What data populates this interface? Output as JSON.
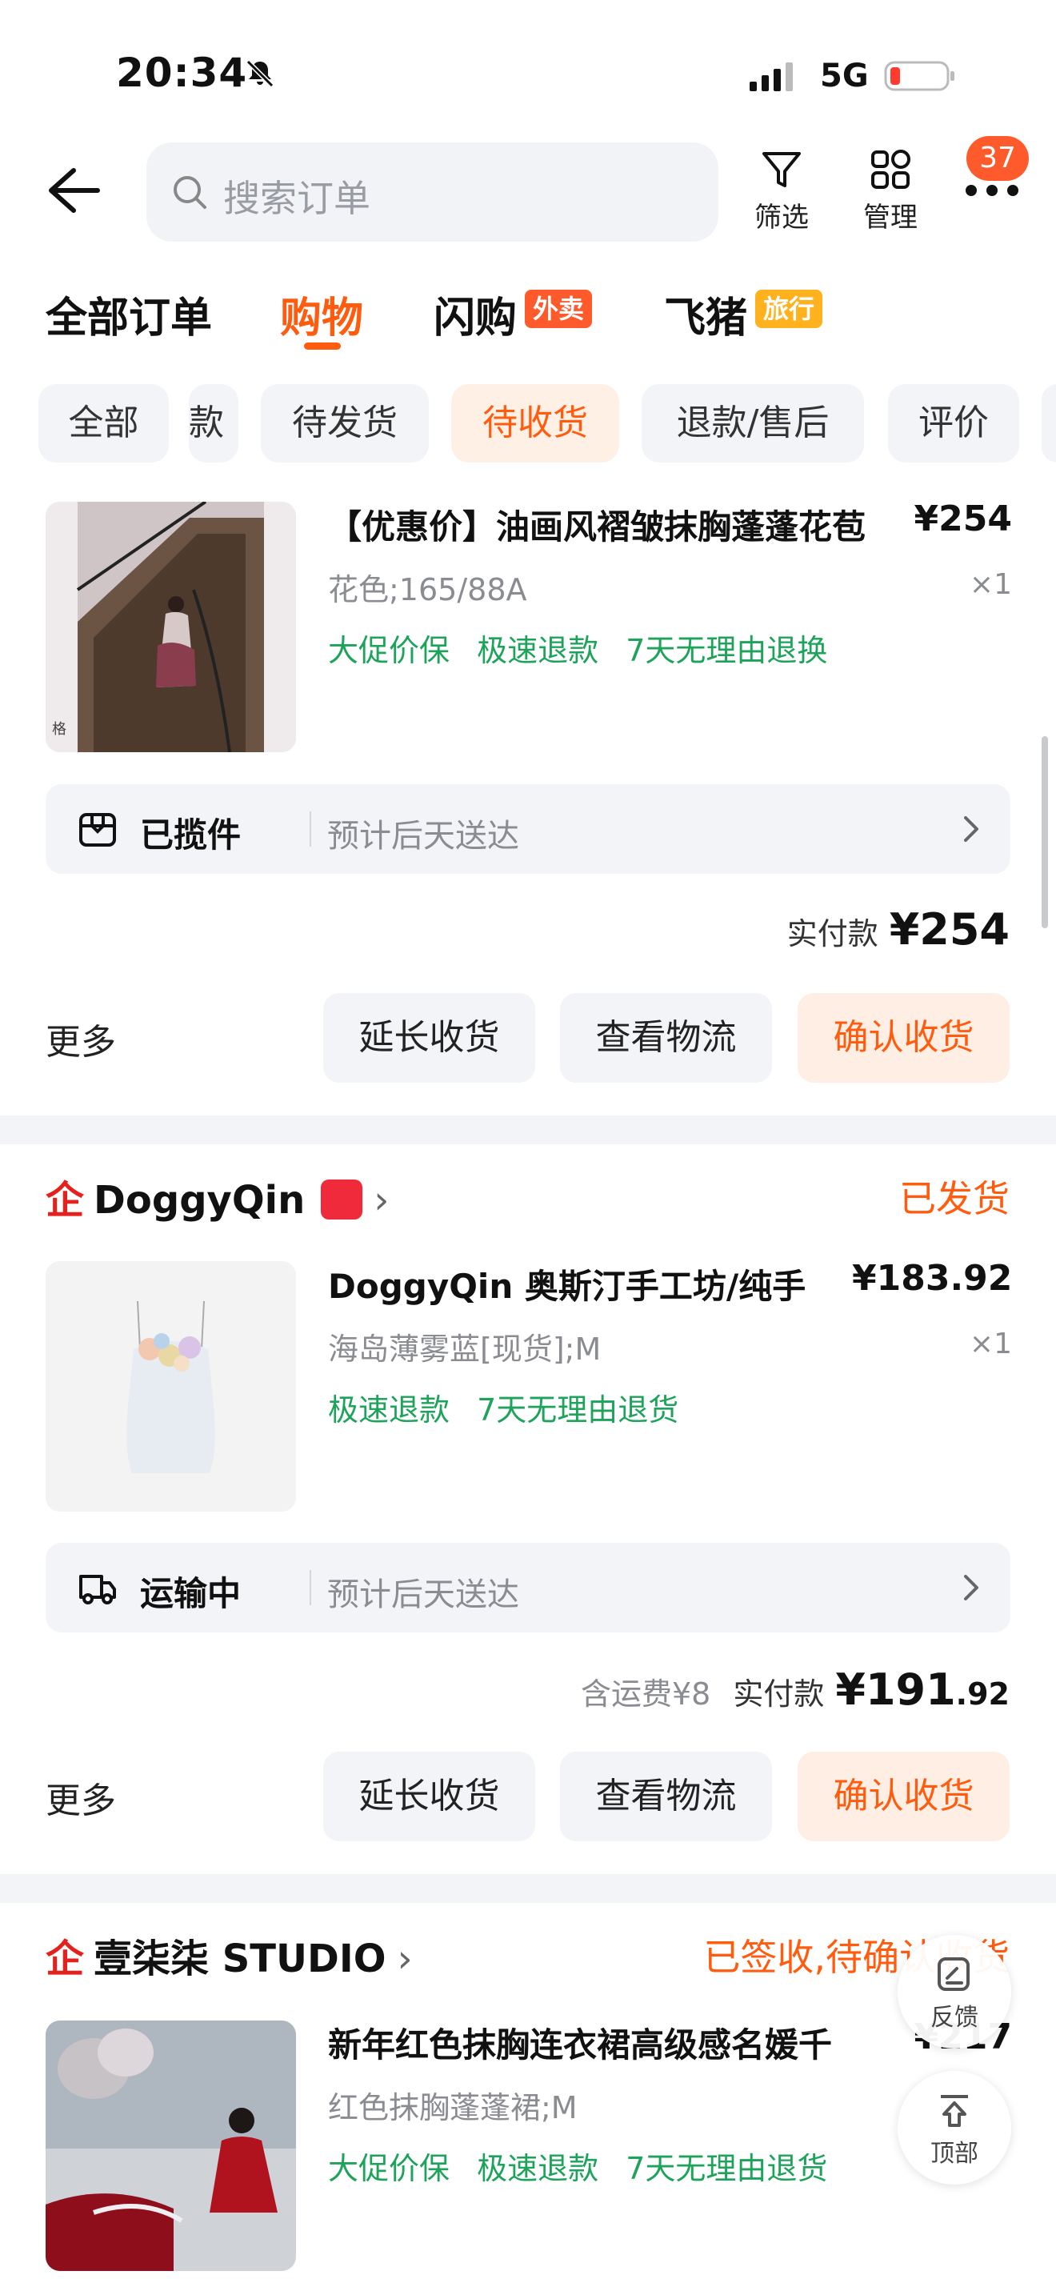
{
  "status_bar": {
    "time": "20:34",
    "network": "5G"
  },
  "header": {
    "search_placeholder": "搜索订单",
    "filter_label": "筛选",
    "manage_label": "管理",
    "message_count": "37"
  },
  "categories": [
    {
      "label": "全部订单"
    },
    {
      "label": "购物"
    },
    {
      "label": "闪购",
      "tag": "外卖"
    },
    {
      "label": "飞猪",
      "tag": "旅行"
    }
  ],
  "status_chips": [
    "全部",
    "款",
    "待发货",
    "待收货",
    "退款/售后",
    "评价"
  ],
  "orders": [
    {
      "title": "【优惠价】油画风褶皱抹胸蓬蓬花苞",
      "price": "¥254",
      "spec": "花色;165/88A",
      "qty": "×1",
      "tags": [
        "大促价保",
        "极速退款",
        "7天无理由退换"
      ],
      "logistics_status": "已揽件",
      "logistics_eta": "预计后天送达",
      "paid_label": "实付款",
      "paid_amount": "¥254",
      "more": "更多",
      "actions": [
        "延长收货",
        "查看物流",
        "确认收货"
      ]
    },
    {
      "shop_name": "DoggyQin",
      "order_status": "已发货",
      "title": "DoggyQin 奥斯汀手工坊/纯手",
      "price": "¥183.92",
      "spec": "海岛薄雾蓝[现货];M",
      "qty": "×1",
      "tags": [
        "极速退款",
        "7天无理由退货"
      ],
      "logistics_status": "运输中",
      "logistics_eta": "预计后天送达",
      "shipping_fee": "含运费¥8",
      "paid_label": "实付款",
      "paid_amount": "¥191",
      "paid_cents": ".92",
      "more": "更多",
      "actions": [
        "延长收货",
        "查看物流",
        "确认收货"
      ]
    },
    {
      "shop_name": "壹柒柒 STUDIO",
      "order_status": "已签收,待确认收货",
      "title": "新年红色抹胸连衣裙高级感名媛千",
      "price": "¥217",
      "spec": "红色抹胸蓬蓬裙;M",
      "tags": [
        "大促价保",
        "极速退款",
        "7天无理由退货"
      ]
    }
  ],
  "floating": {
    "feedback": "反馈",
    "top": "顶部"
  },
  "colors": {
    "accent": "#ff5c0f",
    "green": "#1ea35a",
    "tag_red": "#ff5a2c",
    "tag_yellow": "#ffb21e"
  }
}
